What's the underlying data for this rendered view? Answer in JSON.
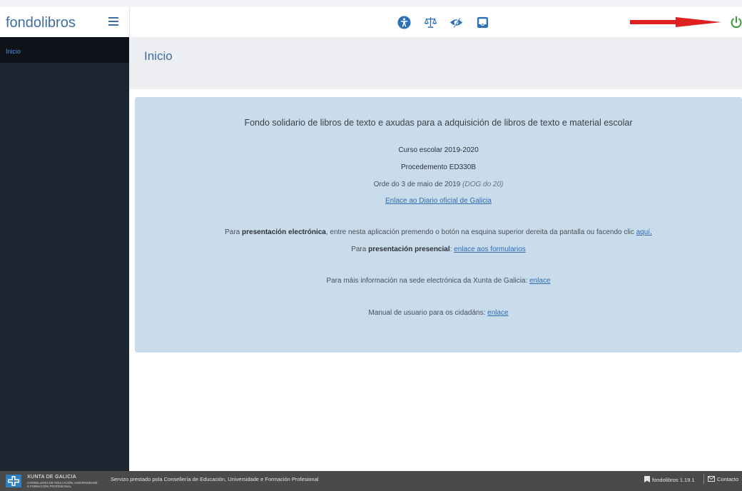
{
  "header": {
    "brand": "fondolibros",
    "icons": [
      "accessibility-icon",
      "scales-icon",
      "eye-contrast-icon",
      "inbox-icon",
      "power-icon"
    ],
    "colors": {
      "brand": "#3d6da3",
      "power": "#3a9b3a",
      "arrow": "#e02020"
    }
  },
  "sidebar": {
    "items": [
      {
        "label": "Inicio"
      }
    ]
  },
  "page": {
    "title": "Inicio"
  },
  "panel": {
    "title": "Fondo solidario de libros de texto e axudas para a adquisición de libros de texto e material escolar",
    "course": "Curso escolar 2019-2020",
    "procedure": "Procedemento ED330B",
    "order": "Orde do 3 de maio de 2019",
    "order_dog": "(DOG do 20)",
    "dog_link": "Enlace ao Diario oficial de Galicia",
    "electronic": {
      "prefix": "Para ",
      "bold": "presentación electrónica",
      "text": ", entre nesta aplicación premendo o botón na esquina superior dereita da pantalla ou facendo clic ",
      "link": "aquí."
    },
    "inperson": {
      "prefix": "Para ",
      "bold": "presentación presencial",
      "text": ": ",
      "link": "enlace aos formularios"
    },
    "moreinfo": {
      "text": "Para máis información na sede electrónica da Xunta de Galicia: ",
      "link": "enlace"
    },
    "manual": {
      "text": "Manual de usuario para os cidadáns: ",
      "link": "enlace"
    }
  },
  "footer": {
    "logo_name": "XUNTA DE GALICIA",
    "logo_sub1": "CONSELLERÍA DE EDUCACIÓN, UNIVERSIDADE",
    "logo_sub2": "E FORMACIÓN PROFESIONAL",
    "service": "Servizo prestado pola Consellería de Educación, Universidade e Formación Profesional",
    "version": "fondolibros 1.19.1",
    "contact": "Contacto"
  }
}
